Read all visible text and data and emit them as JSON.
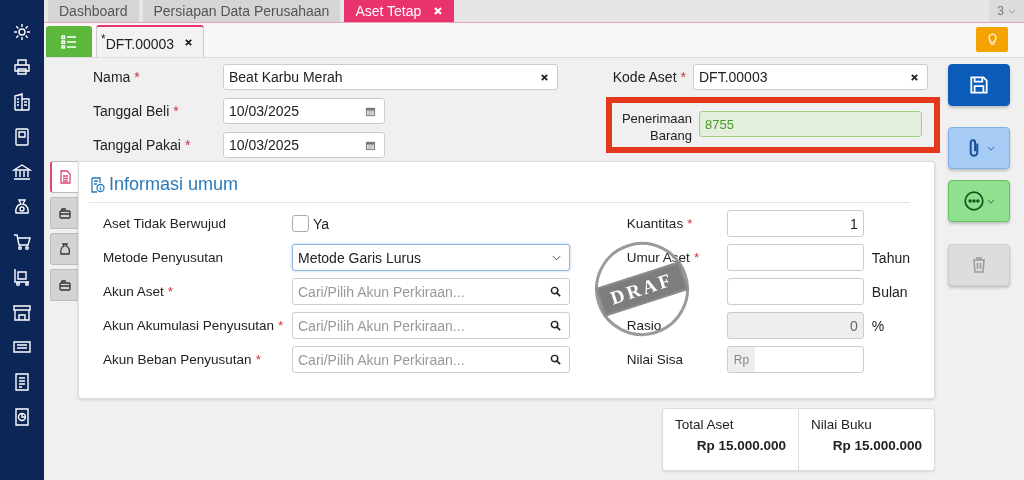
{
  "tabs": [
    {
      "label": "Dashboard",
      "selected": false
    },
    {
      "label": "Persiapan Data Perusahaan",
      "selected": false
    },
    {
      "label": "Aset Tetap",
      "selected": true
    }
  ],
  "tab_count": "3",
  "document_tab": {
    "label": "$^{*}$DFT.00003"
  },
  "header_left": [
    {
      "label": "Nama",
      "mark": "*",
      "kind": "text",
      "value": "Beat Karbu Merah"
    },
    {
      "label": "Tanggal Beli",
      "mark": "*",
      "kind": "date",
      "value": "10/03/2025"
    },
    {
      "label": "Tanggal Pakai",
      "mark": "*",
      "kind": "date",
      "value": "10/03/2025"
    }
  ],
  "header_right": [
    {
      "label": "Kode Aset",
      "mark": "*",
      "kind": "text",
      "value": "DFT.00003",
      "highlighted": false
    },
    {
      "label": "Penerimaan Barang",
      "kind": "linked",
      "value": "8755",
      "highlighted": true
    }
  ],
  "side_tabs": [
    {
      "selected": true
    },
    {
      "selected": false
    },
    {
      "selected": false
    },
    {
      "selected": false
    }
  ],
  "section": {
    "title": "Informasi umum",
    "left_rows": [
      {
        "label": "Aset Tidak Berwujud",
        "kind": "checkbox",
        "checked": false,
        "option": "Ya"
      },
      {
        "label": "Metode Penyusutan",
        "kind": "select",
        "value": "Metode Garis Lurus"
      },
      {
        "label": "Akun Aset",
        "mark": "*",
        "kind": "search",
        "placeholder": "Cari/Pilih Akun Perkiraan..."
      },
      {
        "label": "Akun Akumulasi Penyusutan",
        "mark": "*",
        "kind": "search",
        "placeholder": "Cari/Pilih Akun Perkiraan..."
      },
      {
        "label": "Akun Beban Penyusutan",
        "mark": "*",
        "kind": "search",
        "placeholder": "Cari/Pilih Akun Perkiraan..."
      }
    ],
    "right_rows": [
      {
        "label": "Kuantitas",
        "mark": "*",
        "kind": "number",
        "value": "1"
      },
      {
        "label": "Umur Aset",
        "mark": "*",
        "kind": "number",
        "unit": "Tahun"
      },
      {
        "kind": "number",
        "unit": "Bulan"
      },
      {
        "label": "Rasio",
        "kind": "number",
        "value": "0",
        "unit": "%",
        "disabled": true
      },
      {
        "label": "Nilai Sisa",
        "kind": "currency",
        "prefix": "Rp"
      }
    ],
    "stamp": "DRAF"
  },
  "summary": [
    {
      "label": "Total Aset",
      "value": "Rp 15.000.000"
    },
    {
      "label": "Nilai Buku",
      "value": "Rp 15.000.000"
    }
  ],
  "actions": [
    {
      "kind": "save"
    },
    {
      "kind": "attach"
    },
    {
      "kind": "more"
    },
    {
      "kind": "delete",
      "disabled": true
    }
  ]
}
